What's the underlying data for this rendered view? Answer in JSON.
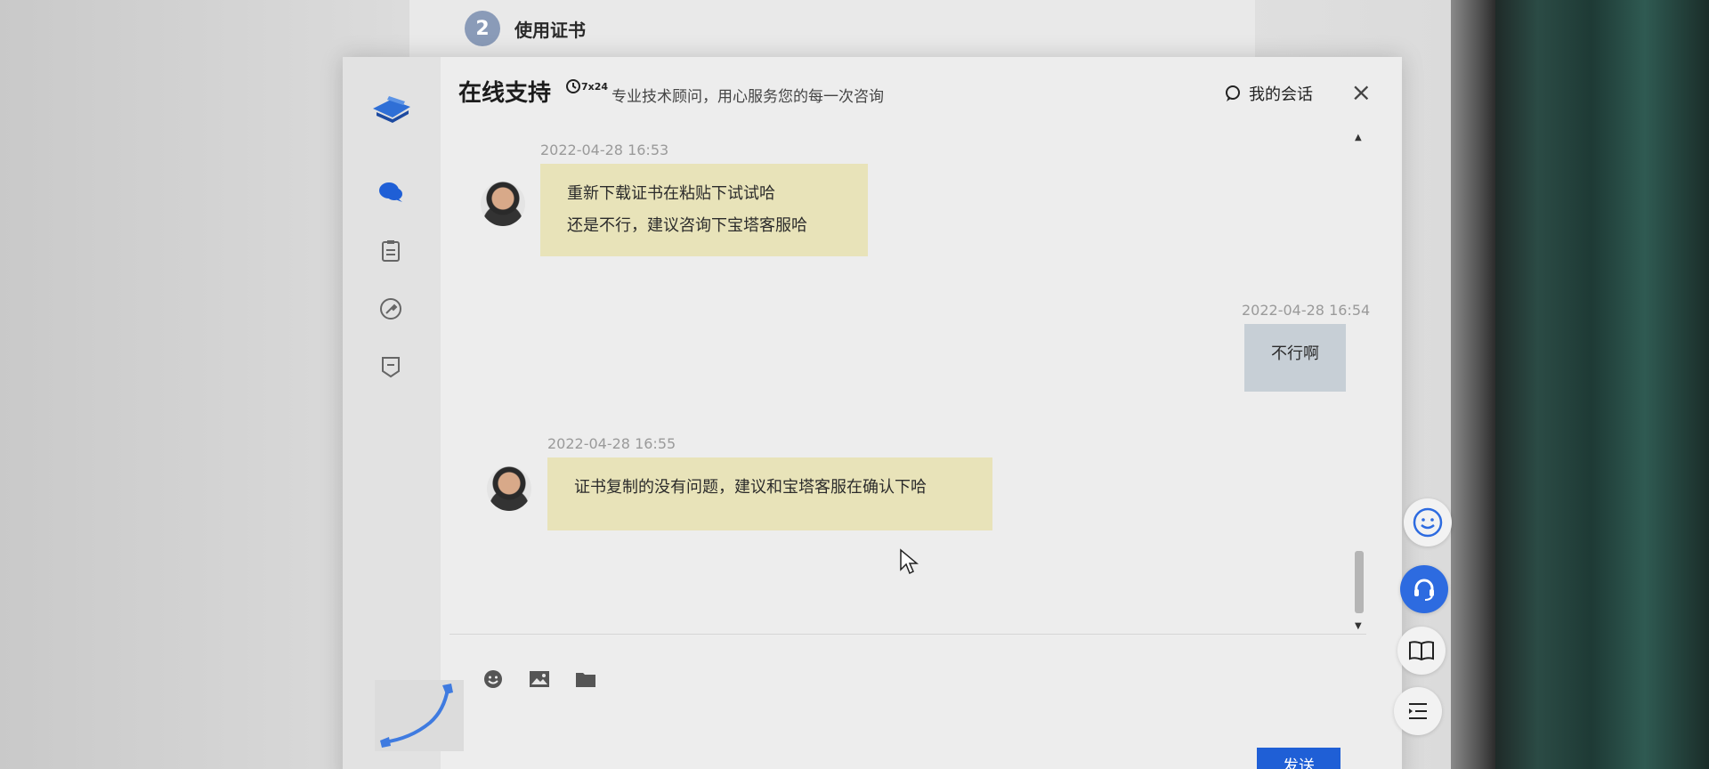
{
  "background": {
    "step_number": "2",
    "step_label": "使用证书"
  },
  "header": {
    "title": "在线支持",
    "badge": "7x24",
    "subtitle": "专业技术顾问，用心服务您的每一次咨询",
    "my_chats": "我的会话",
    "close": "×"
  },
  "messages": [
    {
      "sender": "agent",
      "timestamp": "2022-04-28 16:53",
      "lines": [
        "重新下载证书在粘贴下试试哈",
        "还是不行，建议咨询下宝塔客服哈"
      ]
    },
    {
      "sender": "user",
      "timestamp": "2022-04-28 16:54",
      "lines": [
        "不行啊"
      ]
    },
    {
      "sender": "agent",
      "timestamp": "2022-04-28 16:55",
      "lines": [
        "证书复制的没有问题，建议和宝塔客服在确认下哈"
      ]
    }
  ],
  "composer": {
    "send_label": "发送"
  },
  "icons": {
    "rail": [
      "chat-icon",
      "clipboard-icon",
      "tool-icon",
      "feedback-icon"
    ],
    "toolbar": [
      "emoji-icon",
      "image-icon",
      "folder-icon"
    ],
    "floating": [
      "smile-icon",
      "headset-icon",
      "book-icon",
      "indent-list-icon"
    ]
  },
  "colors": {
    "accent": "#2d6be0",
    "agent_bubble": "#e8e3b9",
    "user_bubble": "#c7cfd6",
    "send_button": "#1f5fd6"
  }
}
